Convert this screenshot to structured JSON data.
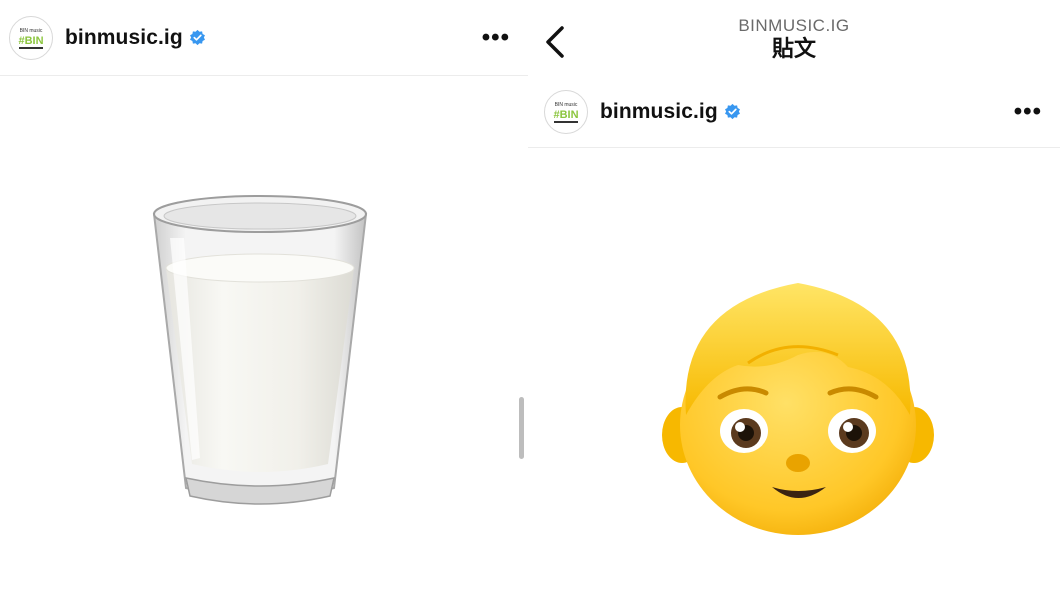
{
  "left_post": {
    "username": "binmusic.ig",
    "avatar_text": "#BIN",
    "avatar_small_text": "BIN music",
    "more_label": "•••",
    "image": "milk-glass-emoji"
  },
  "right_post": {
    "nav": {
      "subtitle": "BINMUSIC.IG",
      "title": "貼文",
      "back_icon": "chevron-left-icon"
    },
    "username": "binmusic.ig",
    "avatar_text": "#BIN",
    "avatar_small_text": "BIN music",
    "more_label": "•••",
    "image": "boy-emoji"
  },
  "colors": {
    "verified": "#3897f0",
    "avatar_accent": "#8cc63f",
    "milk": "#f4f3ee",
    "boy_face": "#ffcc2a",
    "boy_hair": "#ffd53c"
  }
}
